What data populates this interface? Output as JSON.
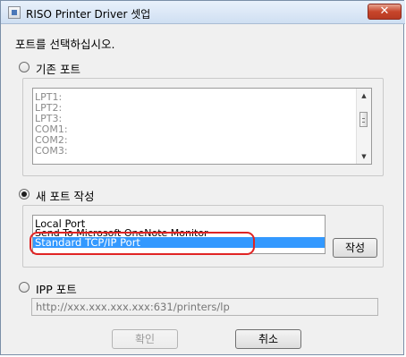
{
  "window": {
    "title": "RISO Printer Driver 셋업",
    "close_label": "✕"
  },
  "prompt": "포트를 선택하십시오.",
  "existing_port": {
    "label": "기존 포트",
    "selected": false,
    "items": [
      "LPT1:",
      "LPT2:",
      "LPT3:",
      "COM1:",
      "COM2:",
      "COM3:"
    ]
  },
  "new_port": {
    "label": "새 포트 작성",
    "selected": true,
    "items": [
      "Local Port",
      "Send To Microsoft OneNote Monitor",
      "Standard TCP/IP Port"
    ],
    "selected_item": "Standard TCP/IP Port",
    "create_button": "작성"
  },
  "ipp_port": {
    "label": "IPP 포트",
    "selected": false,
    "url_value": "http://xxx.xxx.xxx.xxx:631/printers/lp"
  },
  "buttons": {
    "ok": "확인",
    "cancel": "취소"
  },
  "colors": {
    "selection": "#3399ff",
    "highlight_ring": "#e02424",
    "close_button": "#c7452b"
  }
}
